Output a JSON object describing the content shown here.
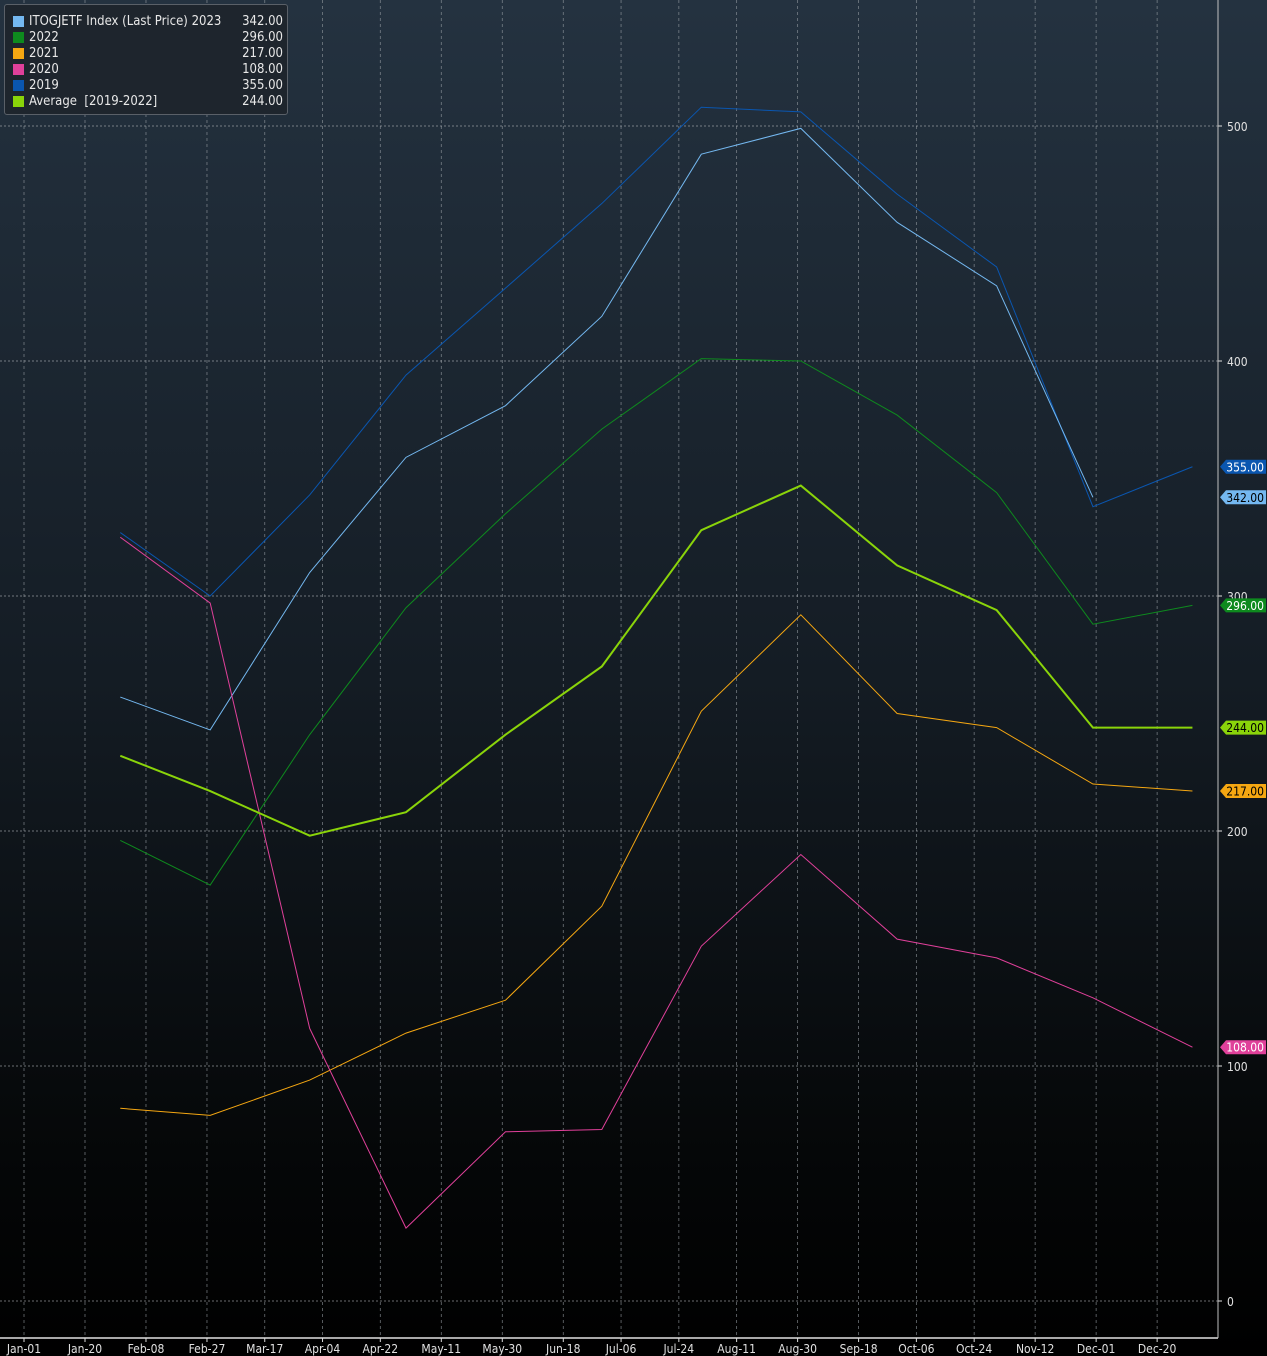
{
  "legend": [
    {
      "label": "ITOGJETF Index (Last Price) 2023",
      "value": "342.00",
      "color": "#74b8f0"
    },
    {
      "label": "2022",
      "value": "296.00",
      "color": "#0e8a1e"
    },
    {
      "label": "2021",
      "value": "217.00",
      "color": "#f5a712"
    },
    {
      "label": "2020",
      "value": "108.00",
      "color": "#e0409a"
    },
    {
      "label": "2019",
      "value": "355.00",
      "color": "#0a56b0"
    },
    {
      "label": "Average  [2019-2022]",
      "value": "244.00",
      "color": "#8ad40a"
    }
  ],
  "chart_data": {
    "type": "line",
    "x": [
      "Jan-31",
      "Feb-28",
      "Mar-31",
      "Apr-30",
      "May-31",
      "Jun-30",
      "Jul-31",
      "Aug-31",
      "Sep-30",
      "Oct-31",
      "Nov-30",
      "Dec-31"
    ],
    "x_tick_labels": [
      "Jan-01",
      "Jan-20",
      "Feb-08",
      "Feb-27",
      "Mar-17",
      "Apr-04",
      "Apr-22",
      "May-11",
      "May-30",
      "Jun-18",
      "Jul-06",
      "Jul-24",
      "Aug-11",
      "Aug-30",
      "Sep-18",
      "Oct-06",
      "Oct-24",
      "Nov-12",
      "Dec-01",
      "Dec-20"
    ],
    "y_ticks": [
      0,
      100,
      200,
      300,
      400,
      500
    ],
    "ylim": [
      0,
      550
    ],
    "y_axis_side": "right",
    "grid": true,
    "legend_placement": "top-left",
    "series": [
      {
        "name": "ITOGJETF Index (Last Price) 2023",
        "color": "#74b8f0",
        "width": 1,
        "values": [
          257,
          243,
          310,
          359,
          381,
          419,
          488,
          499,
          459,
          432,
          342,
          null
        ],
        "last_label": "342.00"
      },
      {
        "name": "2022",
        "color": "#0e8a1e",
        "width": 1,
        "values": [
          196,
          177,
          241,
          295,
          335,
          371,
          401,
          400,
          377,
          344,
          288,
          296
        ],
        "last_label": "296.00"
      },
      {
        "name": "2021",
        "color": "#f5a712",
        "width": 1,
        "values": [
          82,
          79,
          94,
          114,
          128,
          168,
          251,
          292,
          250,
          244,
          220,
          217
        ],
        "last_label": "217.00"
      },
      {
        "name": "2020",
        "color": "#e0409a",
        "width": 1,
        "values": [
          325,
          297,
          116,
          31,
          72,
          73,
          151,
          190,
          154,
          146,
          129,
          108
        ],
        "last_label": "108.00"
      },
      {
        "name": "2019",
        "color": "#0a56b0",
        "width": 1,
        "values": [
          327,
          300,
          343,
          394,
          431,
          467,
          508,
          506,
          471,
          440,
          338,
          355
        ],
        "last_label": "355.00"
      },
      {
        "name": "Average  [2019-2022]",
        "color": "#8ad40a",
        "width": 2,
        "values": [
          232,
          217,
          198,
          208,
          241,
          270,
          328,
          347,
          313,
          294,
          244,
          244
        ],
        "last_label": "244.00"
      }
    ]
  }
}
